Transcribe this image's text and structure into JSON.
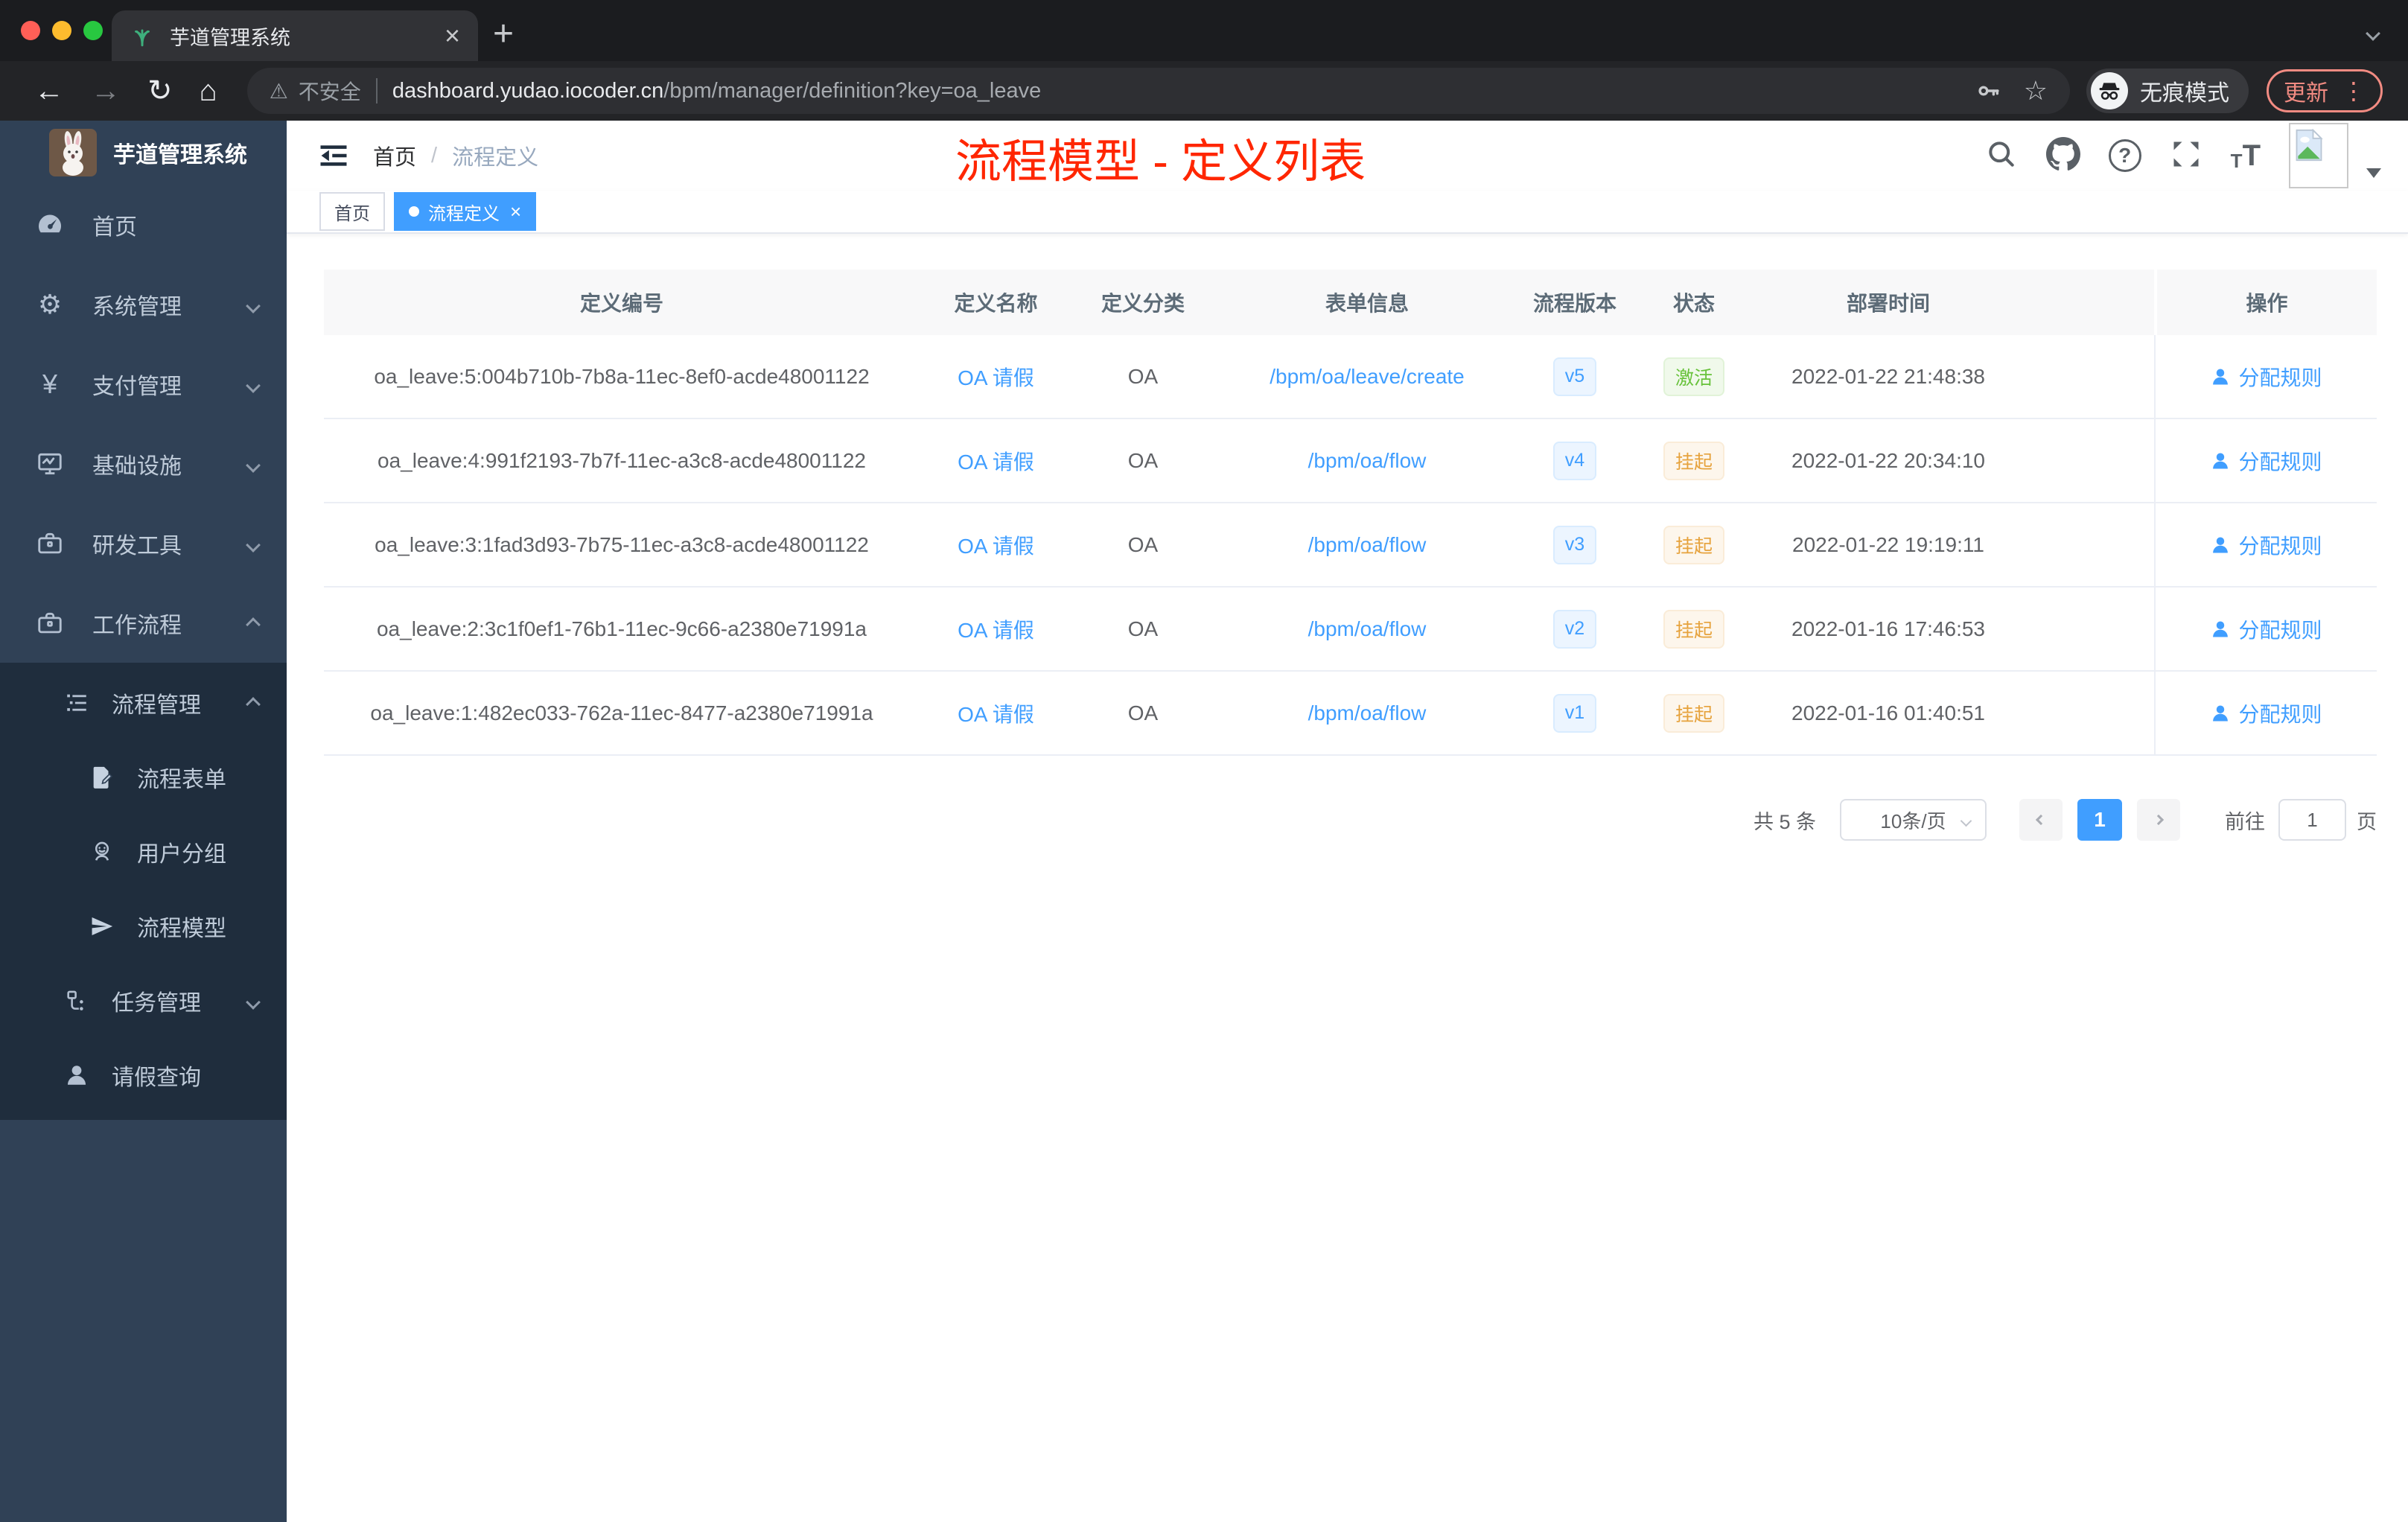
{
  "colors": {
    "accent": "#409eff",
    "success": "#67c23a",
    "warning": "#e6a23c",
    "annotation": "#ff2600"
  },
  "icons": {
    "back": "←",
    "forward": "→",
    "reload": "↻",
    "home": "⌂",
    "warning": "⚠",
    "star": "☆",
    "plus": "+",
    "close": "×",
    "dots": "⋮",
    "gear": "⚙",
    "yen": "¥",
    "question": "?",
    "t_small": "T",
    "t_large": "T"
  },
  "browser": {
    "tab_title": "芋道管理系统",
    "security_label": "不安全",
    "url_domain": "dashboard.yudao.iocoder.cn",
    "url_path": "/bpm/manager/definition?key=oa_leave",
    "incognito_label": "无痕模式",
    "update_label": "更新"
  },
  "sidebar": {
    "title": "芋道管理系统",
    "items": [
      {
        "label": "首页",
        "icon": "dashboard-icon"
      },
      {
        "label": "系统管理",
        "icon": "gear-icon"
      },
      {
        "label": "支付管理",
        "icon": "yen-icon"
      },
      {
        "label": "基础设施",
        "icon": "monitor-icon"
      },
      {
        "label": "研发工具",
        "icon": "toolbox-icon"
      },
      {
        "label": "工作流程",
        "icon": "briefcase-icon"
      },
      {
        "label": "流程管理",
        "icon": "list-icon"
      },
      {
        "label": "流程表单",
        "icon": "form-icon"
      },
      {
        "label": "用户分组",
        "icon": "user-group-icon"
      },
      {
        "label": "流程模型",
        "icon": "paper-plane-icon"
      },
      {
        "label": "任务管理",
        "icon": "tasks-icon"
      },
      {
        "label": "请假查询",
        "icon": "person-icon"
      }
    ]
  },
  "header": {
    "breadcrumb_home": "首页",
    "breadcrumb_sep": "/",
    "breadcrumb_current": "流程定义",
    "annotation": "流程模型 - 定义列表"
  },
  "tags": {
    "home": "首页",
    "active": "流程定义"
  },
  "table": {
    "columns": [
      "定义编号",
      "定义名称",
      "定义分类",
      "表单信息",
      "流程版本",
      "状态",
      "部署时间",
      "操作"
    ],
    "rows": [
      {
        "id": "oa_leave:5:004b710b-7b8a-11ec-8ef0-acde48001122",
        "name": "OA 请假",
        "category": "OA",
        "form": "/bpm/oa/leave/create",
        "version": "v5",
        "status": "激活",
        "deploy_time": "2022-01-22 21:48:38",
        "action": "分配规则"
      },
      {
        "id": "oa_leave:4:991f2193-7b7f-11ec-a3c8-acde48001122",
        "name": "OA 请假",
        "category": "OA",
        "form": "/bpm/oa/flow",
        "version": "v4",
        "status": "挂起",
        "deploy_time": "2022-01-22 20:34:10",
        "action": "分配规则"
      },
      {
        "id": "oa_leave:3:1fad3d93-7b75-11ec-a3c8-acde48001122",
        "name": "OA 请假",
        "category": "OA",
        "form": "/bpm/oa/flow",
        "version": "v3",
        "status": "挂起",
        "deploy_time": "2022-01-22 19:19:11",
        "action": "分配规则"
      },
      {
        "id": "oa_leave:2:3c1f0ef1-76b1-11ec-9c66-a2380e71991a",
        "name": "OA 请假",
        "category": "OA",
        "form": "/bpm/oa/flow",
        "version": "v2",
        "status": "挂起",
        "deploy_time": "2022-01-16 17:46:53",
        "action": "分配规则"
      },
      {
        "id": "oa_leave:1:482ec033-762a-11ec-8477-a2380e71991a",
        "name": "OA 请假",
        "category": "OA",
        "form": "/bpm/oa/flow",
        "version": "v1",
        "status": "挂起",
        "deploy_time": "2022-01-16 01:40:51",
        "action": "分配规则"
      }
    ]
  },
  "pagination": {
    "total": "共 5 条",
    "page_size": "10条/页",
    "current_page": "1",
    "goto_label": "前往",
    "goto_value": "1",
    "goto_unit": "页"
  }
}
